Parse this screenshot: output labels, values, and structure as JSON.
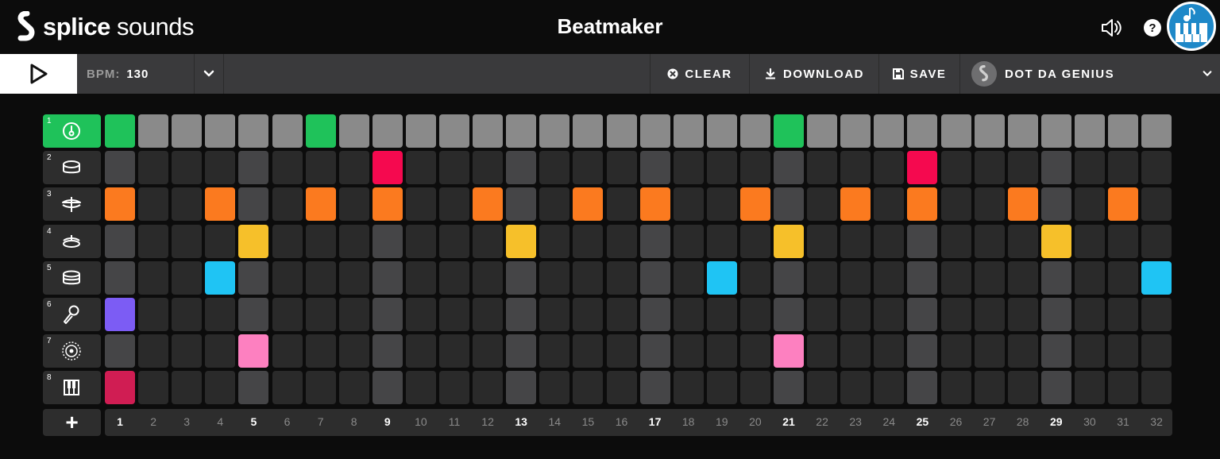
{
  "header": {
    "logo_bold": "splice",
    "logo_light": " sounds",
    "title": "Beatmaker",
    "speaker_icon": "speaker-icon",
    "help_icon": "help-icon",
    "help_glyph": "?"
  },
  "toolbar": {
    "bpm_label": "BPM:",
    "bpm_value": "130",
    "clear_label": "CLEAR",
    "download_label": "DOWNLOAD",
    "save_label": "SAVE",
    "kit_name": "DOT DA GENIUS"
  },
  "colors": {
    "active_row": "#1fc25a",
    "playhead": "#8a8a8a",
    "accent_col": "#454547",
    "empty": "#2a2a2a",
    "row_colors": [
      "#1fc25a",
      "#f5094f",
      "#fb7a1f",
      "#f6c02a",
      "#1fc4f4",
      "#7c5cf4",
      "#fd80c0",
      "#d01d53"
    ]
  },
  "tracks": [
    {
      "num": "1",
      "icon": "kick-icon",
      "active": true,
      "steps": [
        1,
        7,
        21
      ]
    },
    {
      "num": "2",
      "icon": "snare-drum-icon",
      "active": false,
      "steps": [
        9,
        25
      ]
    },
    {
      "num": "3",
      "icon": "hihat-icon",
      "active": false,
      "steps": [
        1,
        4,
        7,
        9,
        12,
        15,
        17,
        20,
        23,
        25,
        28,
        31
      ]
    },
    {
      "num": "4",
      "icon": "cymbal-icon",
      "active": false,
      "steps": [
        5,
        13,
        21,
        29
      ]
    },
    {
      "num": "5",
      "icon": "toms-icon",
      "active": false,
      "steps": [
        4,
        19,
        32
      ]
    },
    {
      "num": "6",
      "icon": "microphone-icon",
      "active": false,
      "steps": [
        1
      ]
    },
    {
      "num": "7",
      "icon": "speaker-cone-icon",
      "active": false,
      "steps": [
        5,
        21
      ]
    },
    {
      "num": "8",
      "icon": "keys-icon",
      "active": false,
      "steps": [
        1
      ]
    }
  ],
  "steps": [
    "1",
    "2",
    "3",
    "4",
    "5",
    "6",
    "7",
    "8",
    "9",
    "10",
    "11",
    "12",
    "13",
    "14",
    "15",
    "16",
    "17",
    "18",
    "19",
    "20",
    "21",
    "22",
    "23",
    "24",
    "25",
    "26",
    "27",
    "28",
    "29",
    "30",
    "31",
    "32"
  ],
  "add_label": "+"
}
